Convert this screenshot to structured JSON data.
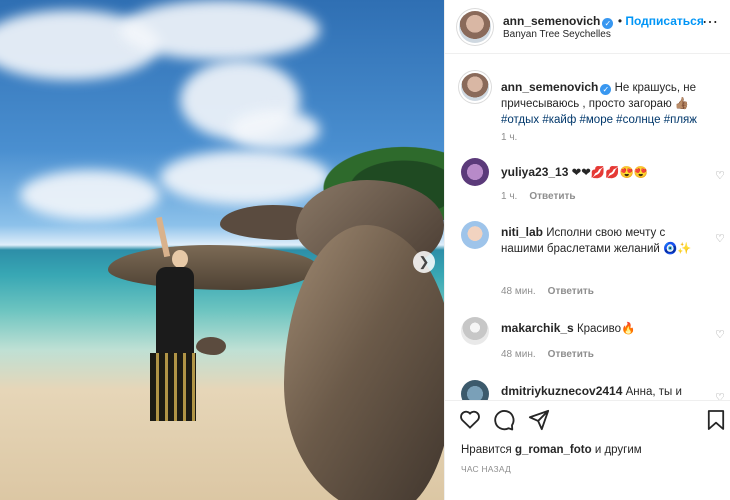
{
  "post": {
    "author": "ann_semenovich",
    "follow_label": "Подписаться",
    "location": "Banyan Tree Seychelles",
    "caption": "Не крашусь, не причесываюсь , просто загораю 👍🏽",
    "hashtags": "#отдых #кайф #море #солнце #пляж",
    "caption_time": "1 ч."
  },
  "comments": [
    {
      "user": "yuliya23_13",
      "text": "❤❤💋💋😍😍",
      "time": "1 ч.",
      "reply": "Ответить"
    },
    {
      "user": "niti_lab",
      "text": "Исполни свою мечту с нашими браслетами желаний 🧿✨",
      "time": "48 мин.",
      "reply": "Ответить"
    },
    {
      "user": "makarchik_s",
      "text": "Красиво🔥",
      "time": "48 мин.",
      "reply": "Ответить"
    },
    {
      "user": "dmitriykuznecov2414",
      "text": "Анна, ты и",
      "time": "",
      "reply": ""
    }
  ],
  "likes": {
    "prefix": "Нравится",
    "user": "g_roman_foto",
    "suffix": "и другим"
  },
  "posted_ago": "ЧАС НАЗАД",
  "icons": {
    "like": "heart-icon",
    "comment": "comment-icon",
    "share": "share-icon",
    "save": "bookmark-icon",
    "more": "more-icon",
    "next": "chevron-right-icon"
  }
}
